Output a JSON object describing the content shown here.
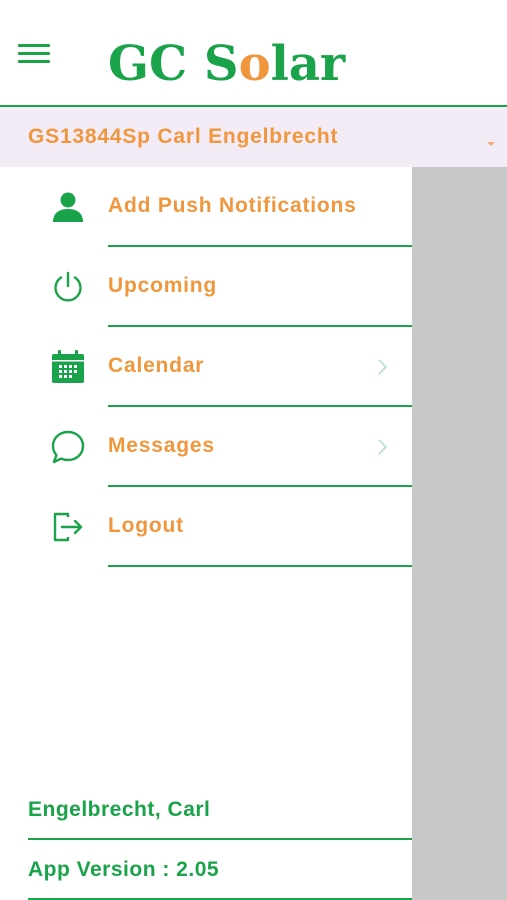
{
  "header": {
    "menu_icon": "hamburger-menu-icon",
    "logo": {
      "part1": "GC S",
      "part2": "o",
      "part3": "lar"
    },
    "brand_color": "#1aa34a",
    "accent_color": "#f0973d"
  },
  "account": {
    "selected": "GS13844Sp Carl Engelbrecht",
    "caret_icon": "caret-down-icon"
  },
  "menu": {
    "items": [
      {
        "label": "Add Push Notifications",
        "icon": "user-icon",
        "has_chevron": false
      },
      {
        "label": "Upcoming",
        "icon": "power-icon",
        "has_chevron": false
      },
      {
        "label": "Calendar",
        "icon": "calendar-icon",
        "has_chevron": true
      },
      {
        "label": "Messages",
        "icon": "chat-bubble-icon",
        "has_chevron": true
      },
      {
        "label": "Logout",
        "icon": "logout-icon",
        "has_chevron": false
      }
    ]
  },
  "footer": {
    "user_name": "Engelbrecht, Carl",
    "app_version": "App Version : 2.05"
  }
}
